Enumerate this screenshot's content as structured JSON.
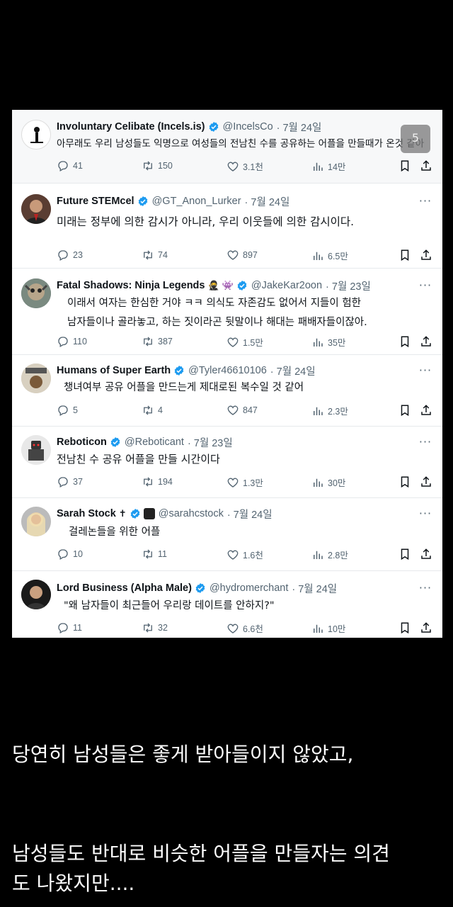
{
  "tweets": [
    {
      "name": "Involuntary Celibate (Incels.is)",
      "handle": "@IncelsCo",
      "date": "· 7월 24일",
      "text": [
        "아무래도 우리 남성들도 익명으로 여성들의 전남친 수를 공유하는 어플을 만들때가 온것 같아"
      ],
      "replies": "41",
      "retweets": "150",
      "likes": "3.1천",
      "views": "14만"
    },
    {
      "name": "Future STEMcel",
      "handle": "@GT_Anon_Lurker",
      "date": "· 7월 24일",
      "text": [
        "미래는 정부에 의한 감시가 아니라, 우리 이웃들에 의한 감시이다."
      ],
      "replies": "23",
      "retweets": "74",
      "likes": "897",
      "views": "6.5만"
    },
    {
      "name": "Fatal Shadows: Ninja Legends",
      "handle": "@JakeKar2oon",
      "date": "· 7월 23일",
      "text": [
        "이래서 여자는 한심한 거야 ㅋㅋ 의식도 자존감도 없어서 지들이 험한",
        "남자들이나 골라놓고, 하는 짓이라곤 뒷말이나 해대는 패배자들이잖아."
      ],
      "replies": "110",
      "retweets": "387",
      "likes": "1.5만",
      "views": "35만"
    },
    {
      "name": "Humans of Super Earth",
      "handle": "@Tyler46610106",
      "date": "· 7월 24일",
      "text": [
        "챙녀여부 공유 어플을 만드는게 제대로된 복수일 것 같어"
      ],
      "replies": "5",
      "retweets": "4",
      "likes": "847",
      "views": "2.3만"
    },
    {
      "name": "Reboticon",
      "handle": "@Reboticant",
      "date": "· 7월 23일",
      "text": [
        "전남친 수 공유 어플을 만들 시간이다"
      ],
      "replies": "37",
      "retweets": "194",
      "likes": "1.3만",
      "views": "30만"
    },
    {
      "name": "Sarah Stock",
      "handle": "@sarahcstock",
      "date": "· 7월 24일",
      "text": [
        "걸레논들을 위한 어플"
      ],
      "replies": "10",
      "retweets": "11",
      "likes": "1.6천",
      "views": "2.8만"
    },
    {
      "name": "Lord Business (Alpha Male)",
      "handle": "@hydromerchant",
      "date": "· 7월 24일",
      "text": [
        "\"왜 남자들이 최근들어 우리랑 데이트를 안하지?\""
      ],
      "replies": "11",
      "retweets": "32",
      "likes": "6.6천",
      "views": "10만"
    }
  ],
  "overlay_badge": "5",
  "captions": {
    "line1": "당연히 남성들은 좋게 받아들이지 않았고,",
    "line2a": "남성들도 반대로 비슷한 어플을 만들자는 의견",
    "line2b": "도 나왔지만...."
  },
  "colors": {
    "verified": "#1d9bf0",
    "muted": "#536471",
    "background": "#000000"
  },
  "icons": [
    "reply-icon",
    "retweet-icon",
    "like-icon",
    "views-icon",
    "bookmark-icon",
    "share-icon",
    "verified-icon",
    "more-icon"
  ]
}
